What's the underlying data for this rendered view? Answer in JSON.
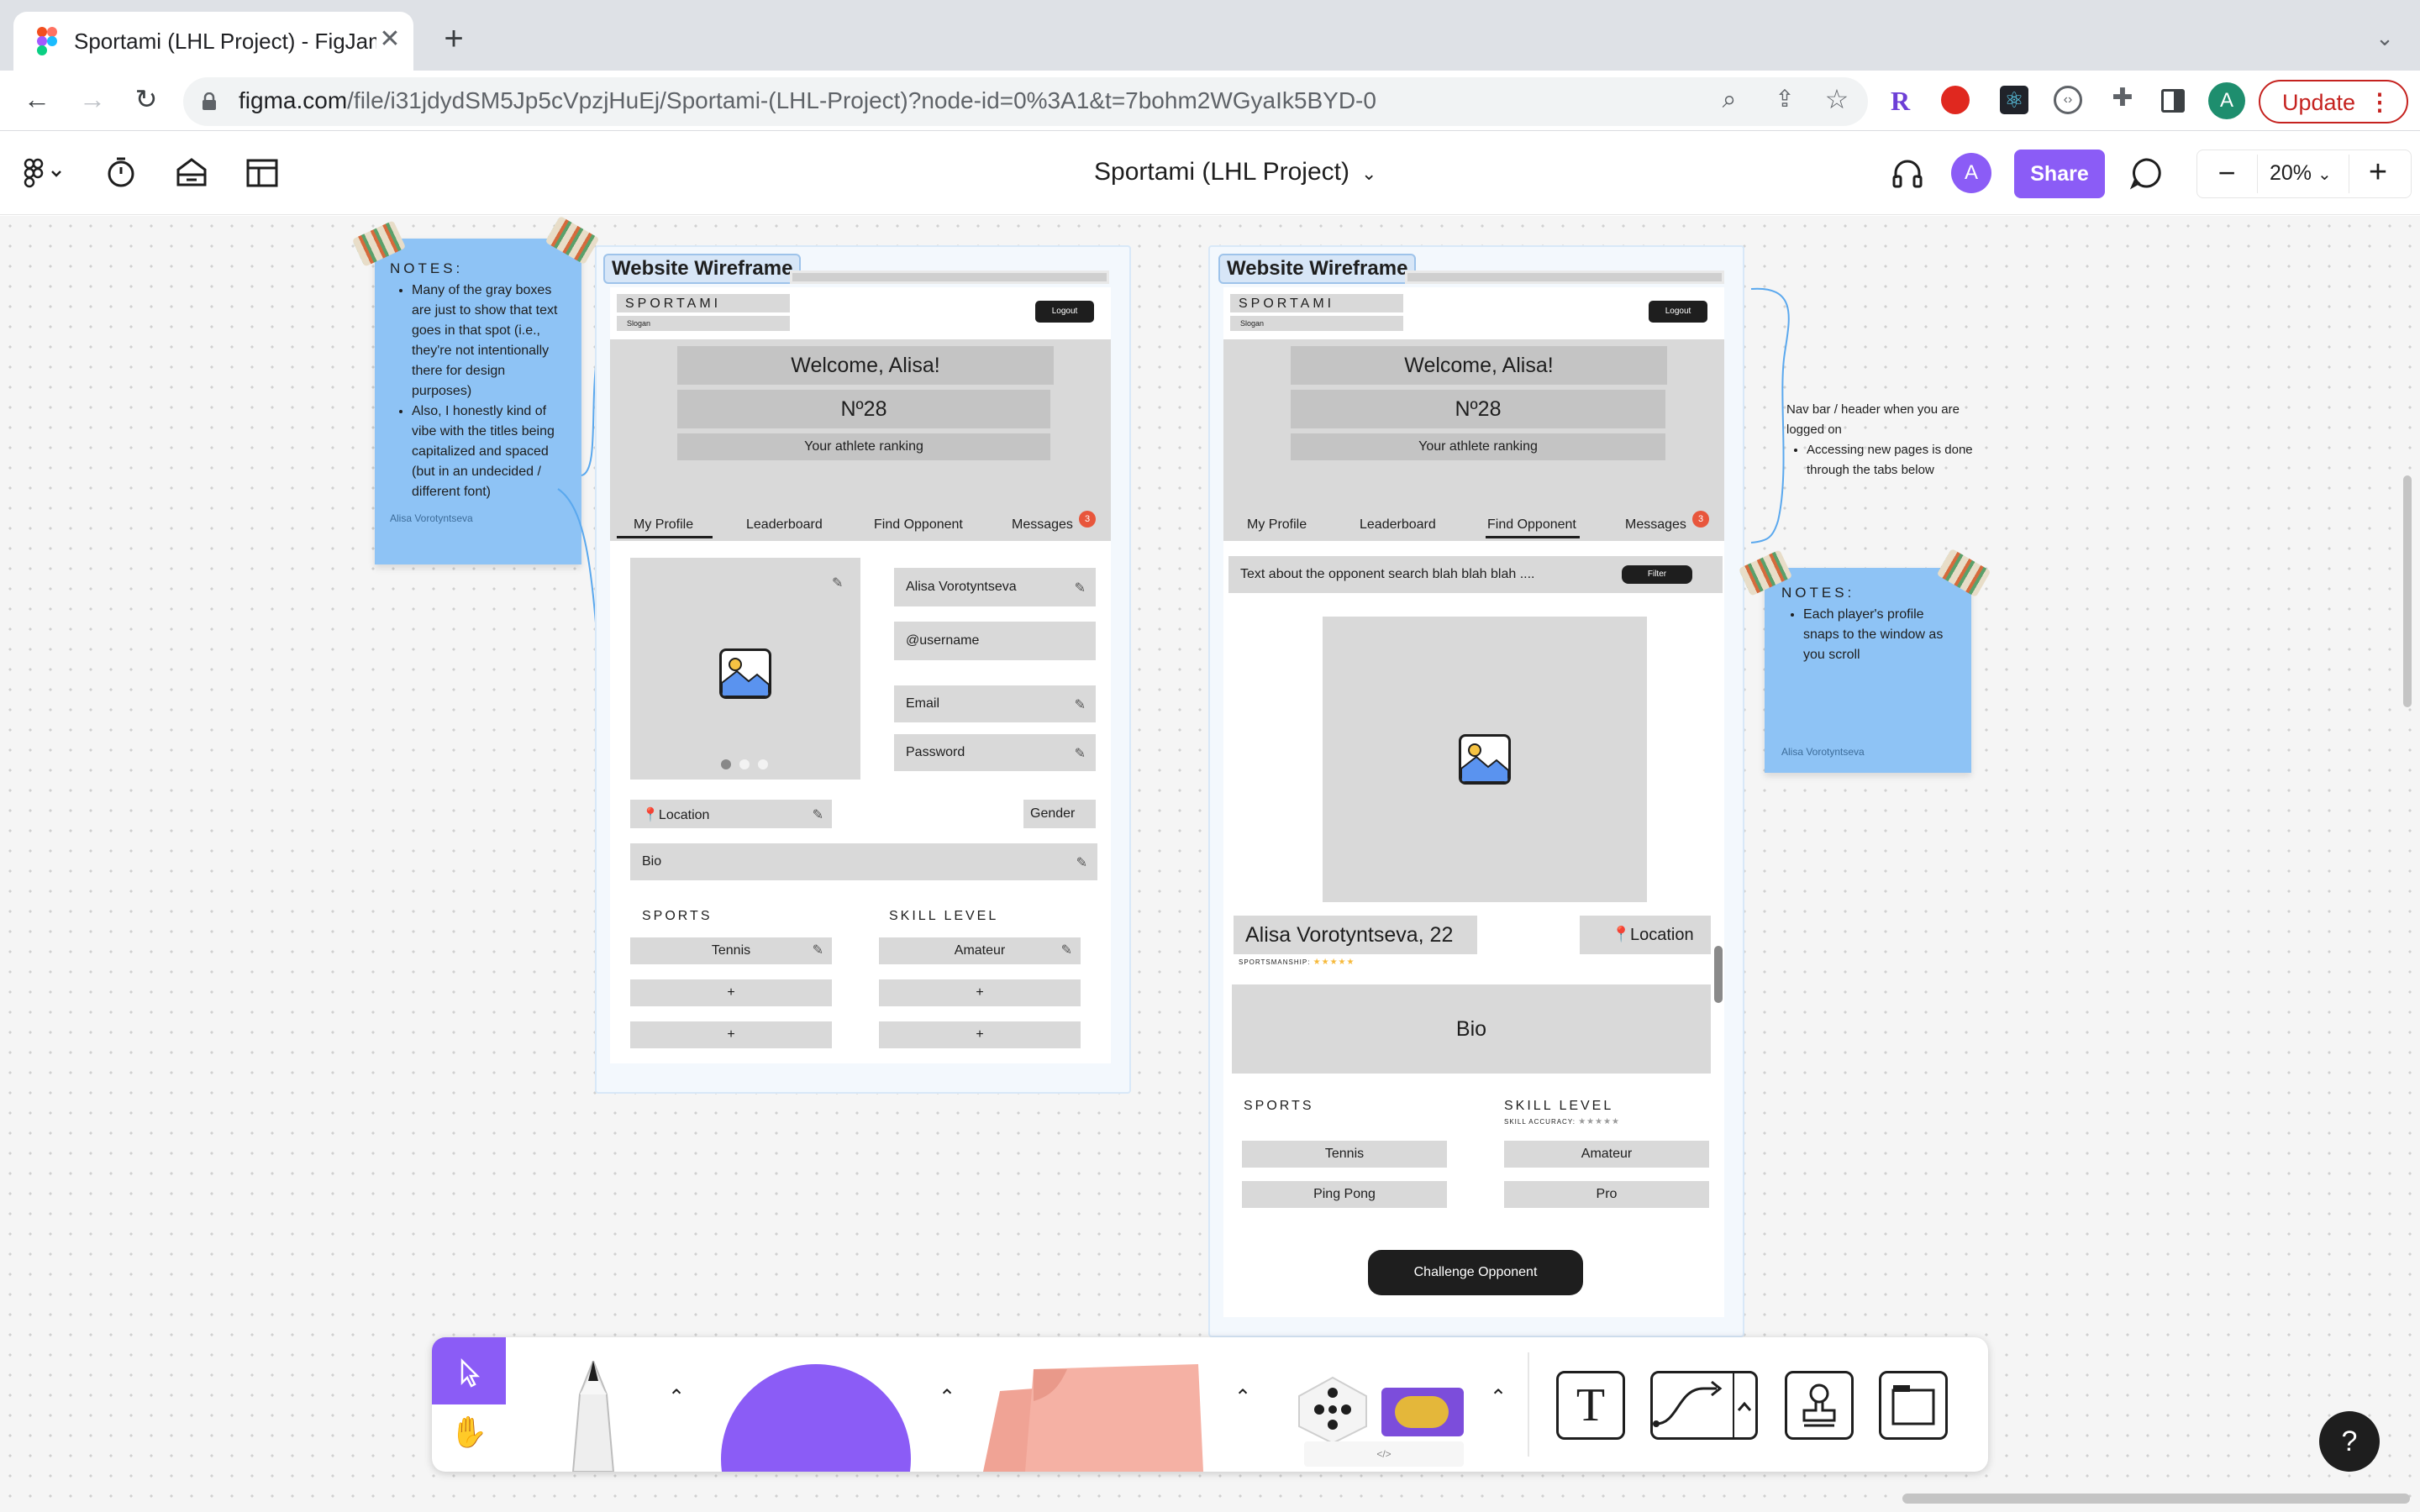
{
  "browser": {
    "tab_title": "Sportami (LHL Project) - FigJam",
    "new_tab": "+",
    "url_host": "figma.com",
    "url_path": "/file/i31jdydSM5Jp5cVpzjHuEj/Sportami-(LHL-Project)?node-id=0%3A1&t=7bohm2WGyaIk5BYD-0",
    "update_label": "Update",
    "profile_initial": "A"
  },
  "figma": {
    "file_title": "Sportami (LHL Project)",
    "share_label": "Share",
    "avatar_initial": "A",
    "zoom": "20%"
  },
  "notes_left": {
    "heading": "NOTES:",
    "items": [
      "Many of the gray boxes are just to show that text goes in that spot (i.e., they're not intentionally there for design purposes)",
      "Also, I honestly kind of vibe with the titles being capitalized and spaced (but in an undecided / different font)"
    ],
    "author": "Alisa Vorotyntseva"
  },
  "wireframe1": {
    "label": "Website Wireframe",
    "brand": "SPORTAMI",
    "slogan": "Slogan",
    "logout": "Logout",
    "welcome": "Welcome, Alisa!",
    "rank": "Nº28",
    "rank_caption": "Your athlete ranking",
    "tabs": [
      "My Profile",
      "Leaderboard",
      "Find Opponent",
      "Messages"
    ],
    "badge": "3",
    "name_field": "Alisa Vorotyntseva",
    "username_field": "@username",
    "email_field": "Email",
    "password_field": "Password",
    "location_field": "Location",
    "gender_field": "Gender",
    "bio_field": "Bio",
    "sports_heading": "SPORTS",
    "skill_heading": "SKILL LEVEL",
    "sport_1": "Tennis",
    "skill_1": "Amateur",
    "plus": "+"
  },
  "wireframe2": {
    "label": "Website Wireframe",
    "brand": "SPORTAMI",
    "slogan": "Slogan",
    "logout": "Logout",
    "welcome": "Welcome, Alisa!",
    "rank": "Nº28",
    "rank_caption": "Your athlete ranking",
    "tabs": [
      "My Profile",
      "Leaderboard",
      "Find Opponent",
      "Messages"
    ],
    "badge": "3",
    "search_text": "Text about the opponent search blah blah blah ....",
    "filter": "Filter",
    "player_name": "Alisa Vorotyntseva, 22",
    "location": "Location",
    "sportsmanship": "SPORTSMANSHIP:",
    "bio": "Bio",
    "sports_heading": "SPORTS",
    "skill_heading": "SKILL LEVEL",
    "skill_accuracy": "SKILL ACCURACY:",
    "sports": [
      "Tennis",
      "Ping Pong"
    ],
    "skills": [
      "Amateur",
      "Pro"
    ],
    "challenge": "Challenge Opponent",
    "stars": "★★★★★"
  },
  "annotation_nav": {
    "title": "Nav bar / header when you are logged on",
    "bullet": "Accessing new pages is done through the tabs below"
  },
  "notes_right": {
    "heading": "NOTES:",
    "items": [
      "Each player's profile snaps to the window as you scroll"
    ],
    "author": "Alisa Vorotyntseva"
  },
  "dock": {
    "help": "?"
  }
}
